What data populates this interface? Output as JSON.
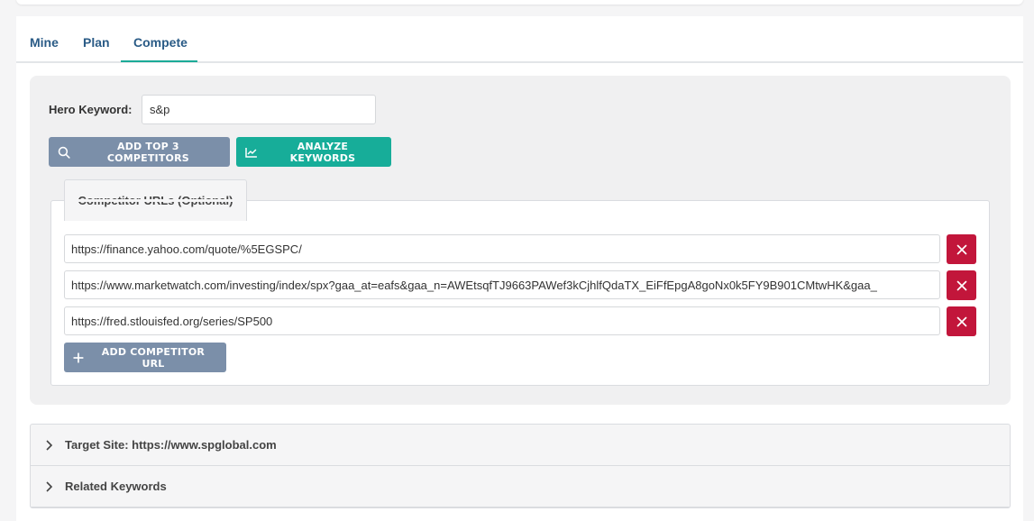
{
  "tabs": [
    {
      "label": "Mine"
    },
    {
      "label": "Plan"
    },
    {
      "label": "Compete"
    }
  ],
  "active_tab": "Compete",
  "hero": {
    "label": "Hero Keyword:",
    "value": "s&p"
  },
  "actions": {
    "add_competitors_label": "ADD TOP 3 COMPETITORS",
    "analyze_label": "ANALYZE KEYWORDS"
  },
  "competitors": {
    "legend": "Competitor URLs (Optional)",
    "urls": [
      "https://finance.yahoo.com/quote/%5EGSPC/",
      "https://www.marketwatch.com/investing/index/spx?gaa_at=eafs&gaa_n=AWEtsqfTJ9663PAWef3kCjhlfQdaTX_EiFfEpgA8goNx0k5FY9B901CMtwHK&gaa_",
      "https://fred.stlouisfed.org/series/SP500"
    ],
    "add_label": "ADD COMPETITOR URL"
  },
  "accordion": [
    {
      "label": "Target Site: https://www.spglobal.com"
    },
    {
      "label": "Related Keywords"
    }
  ],
  "colors": {
    "accent_teal": "#17ad99",
    "button_grey": "#7b8fa9",
    "danger": "#c2163b",
    "tab_text": "#2a5b86"
  }
}
